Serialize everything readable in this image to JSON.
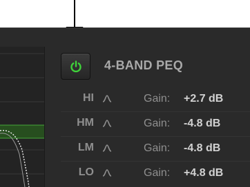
{
  "plugin": {
    "title": "4-BAND PEQ",
    "bypass_button": {
      "icon": "power-icon",
      "state": "on",
      "color": "#3fd23a"
    }
  },
  "bands": [
    {
      "name": "HI",
      "shape_icon": "bell-icon",
      "gain_label": "Gain:",
      "gain_value": "+2.7 dB"
    },
    {
      "name": "HM",
      "shape_icon": "bell-icon",
      "gain_label": "Gain:",
      "gain_value": "-4.8 dB"
    },
    {
      "name": "LM",
      "shape_icon": "bell-icon",
      "gain_label": "Gain:",
      "gain_value": "-4.8 dB"
    },
    {
      "name": "LO",
      "shape_icon": "bell-icon",
      "gain_label": "Gain:",
      "gain_value": "+4.8 dB"
    }
  ],
  "colors": {
    "panel_bg": "#2a2a2a",
    "accent_green": "#3fd23a",
    "text_dim": "#8f8f8f",
    "text_bright": "#d2d2d2"
  }
}
